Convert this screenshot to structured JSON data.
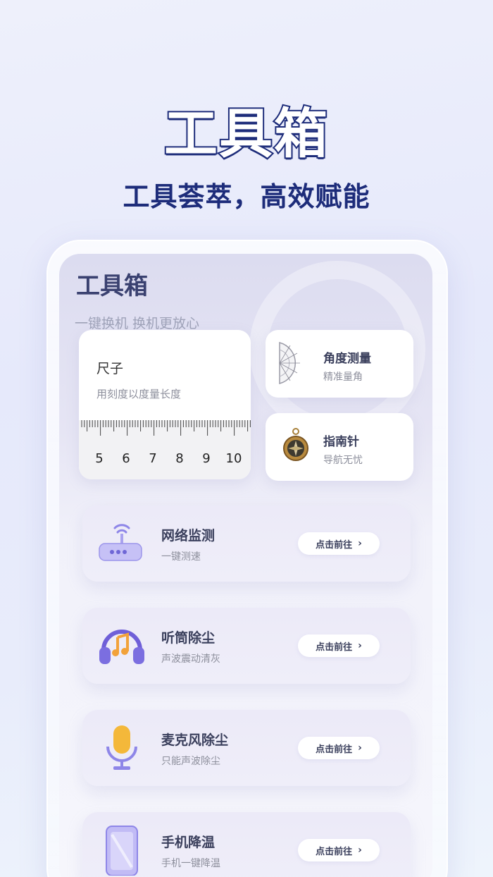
{
  "hero": {
    "title": "工具箱",
    "subtitle": "工具荟萃，高效赋能"
  },
  "screen": {
    "title": "工具箱",
    "subtitle": "一键换机 换机更放心"
  },
  "ruler": {
    "title": "尺子",
    "desc": "用刻度以度量长度",
    "ticks": [
      "5",
      "6",
      "7",
      "8",
      "9",
      "10"
    ]
  },
  "angle": {
    "title": "角度测量",
    "desc": "精准量角",
    "icon": "protractor-icon"
  },
  "compass": {
    "title": "指南针",
    "desc": "导航无忧",
    "icon": "compass-icon"
  },
  "tools": [
    {
      "title": "网络监测",
      "desc": "一键测速",
      "button": "点击前往",
      "icon": "router-icon"
    },
    {
      "title": "听筒除尘",
      "desc": "声波震动清灰",
      "button": "点击前往",
      "icon": "headphones-icon"
    },
    {
      "title": "麦克风除尘",
      "desc": "只能声波除尘",
      "button": "点击前往",
      "icon": "microphone-icon"
    },
    {
      "title": "手机降温",
      "desc": "手机一键降温",
      "button": "点击前往",
      "icon": "phone-icon"
    }
  ],
  "colors": {
    "brand_navy": "#1d2c7a",
    "accent_purple": "#7b6ee0",
    "text_dark": "#3a3f5c"
  }
}
